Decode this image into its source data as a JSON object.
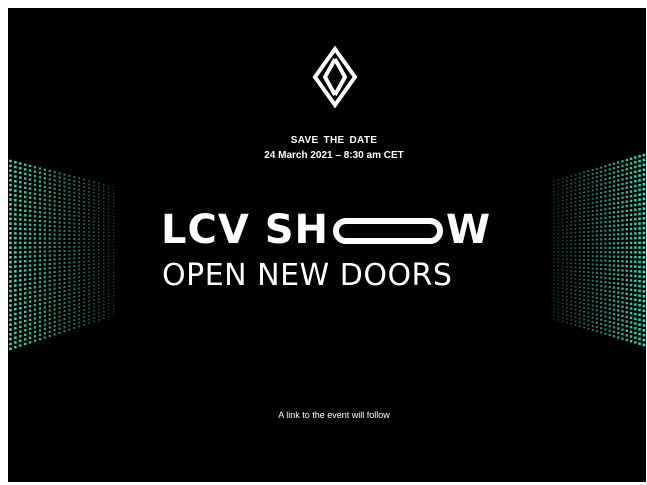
{
  "invite": {
    "logo_icon": "renault-diamond-logo-icon",
    "save_title": "SAVE  THE  DATE",
    "date_line": "24 March 2021 – 8:30 am CET",
    "headline_start": "LCV SH",
    "headline_end": "W",
    "subline": "OPEN NEW DOORS",
    "footer_note": "A link to the event will follow"
  },
  "colors": {
    "background": "#000000",
    "text": "#ffffff",
    "led_accent": "#3be0b8"
  }
}
